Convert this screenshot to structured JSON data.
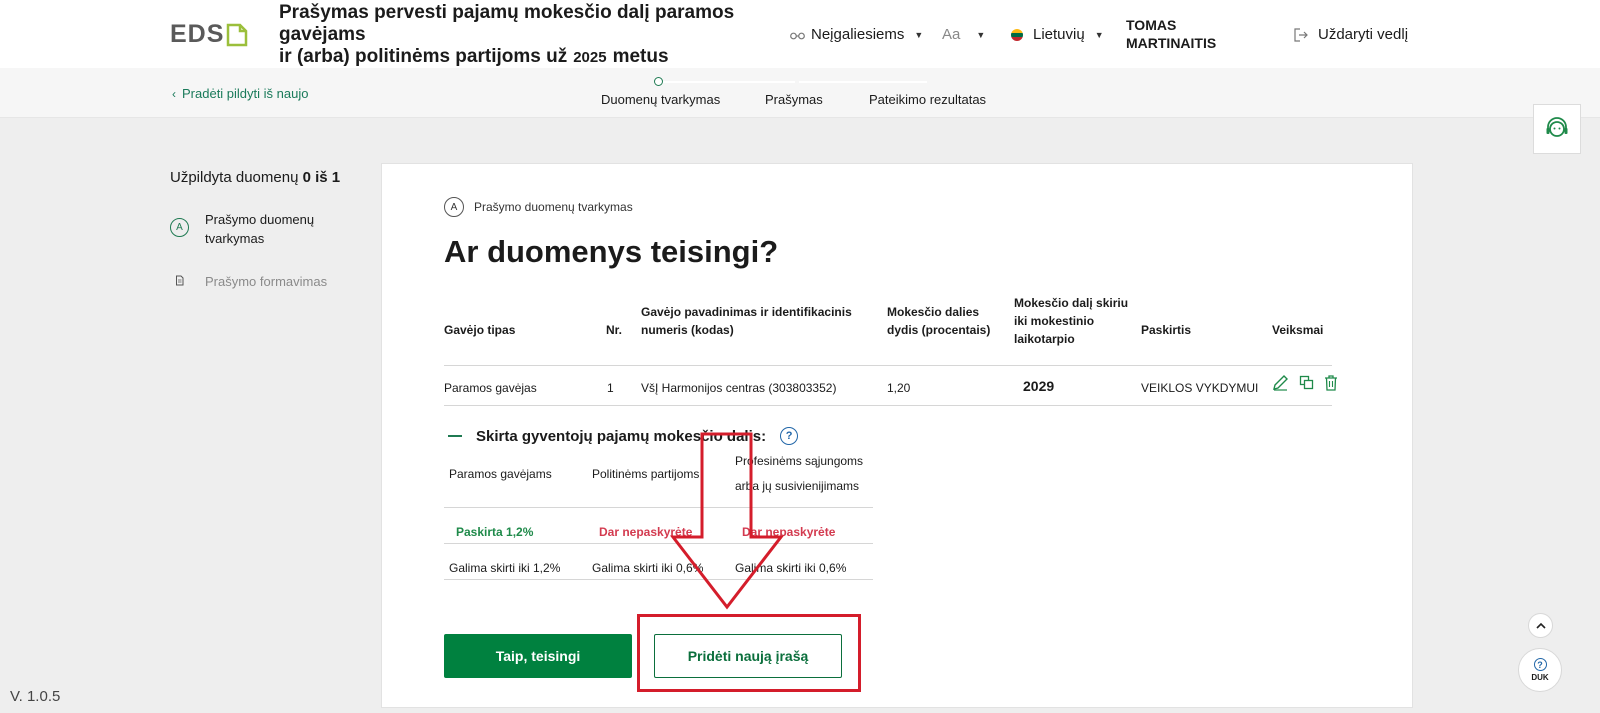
{
  "header": {
    "logo_text": "EDS",
    "title_line1": "Prašymas pervesti pajamų mokesčio dalį paramos",
    "title_line2": "gavėjams",
    "title_line3_pre": "ir (arba) politinėms partijoms už",
    "title_year": "2025",
    "title_line3_post": "metus",
    "accessibility_label": "Neįgaliesiems",
    "font_size_label": "Aa",
    "language_label": "Lietuvių",
    "user_name": "TOMAS MARTINAITIS",
    "close_label": "Uždaryti vedlį"
  },
  "stepbar": {
    "restart_label": "Pradėti pildyti iš naujo",
    "steps": [
      {
        "label": "Duomenų tvarkymas"
      },
      {
        "label": "Prašymas"
      },
      {
        "label": "Pateikimo rezultatas"
      }
    ]
  },
  "sidebar": {
    "progress_prefix": "Užpildyta duomenų",
    "progress_value": "0 iš 1",
    "items": [
      {
        "badge": "A",
        "label": "Prašymo duomenų tvarkymas"
      },
      {
        "label": "Prašymo formavimas"
      }
    ]
  },
  "main": {
    "crumb_badge": "A",
    "crumb_label": "Prašymo duomenų tvarkymas",
    "heading": "Ar duomenys teisingi?",
    "columns": [
      "Gavėjo tipas",
      "Nr.",
      "Gavėjo pavadinimas ir identifikacinis numeris (kodas)",
      "Mokesčio dalies dydis (procentais)",
      "Mokesčio dalį skiriu iki mokestinio laikotarpio",
      "Paskirtis",
      "Veiksmai"
    ],
    "row": {
      "type": "Paramos gavėjas",
      "nr": "1",
      "name": "VšĮ Harmonijos centras (303803352)",
      "percent": "1,20",
      "until": "2029",
      "purpose": "VEIKLOS VYKDYMUI"
    },
    "summary_title": "Skirta gyventojų pajamų mokesčio dalis:",
    "summary_columns": [
      "Paramos gavėjams",
      "Politinėms partijoms",
      "Profesinėms sąjungoms arba jų susivienijimams"
    ],
    "summary_status": [
      "Paskirta 1,2%",
      "Dar nepaskyrėte",
      "Dar nepaskyrėte"
    ],
    "summary_limits": [
      "Galima skirti iki 1,2%",
      "Galima skirti iki 0,6%",
      "Galima skirti iki 0,6%"
    ],
    "btn_confirm": "Taip, teisingi",
    "btn_add": "Pridėti naują įrašą"
  },
  "footer": {
    "version": "V. 1.0.5",
    "faq_label": "DUK"
  },
  "colors": {
    "primary": "#00813f",
    "highlight": "#d41d2b",
    "warning_text": "#d33a4f"
  }
}
